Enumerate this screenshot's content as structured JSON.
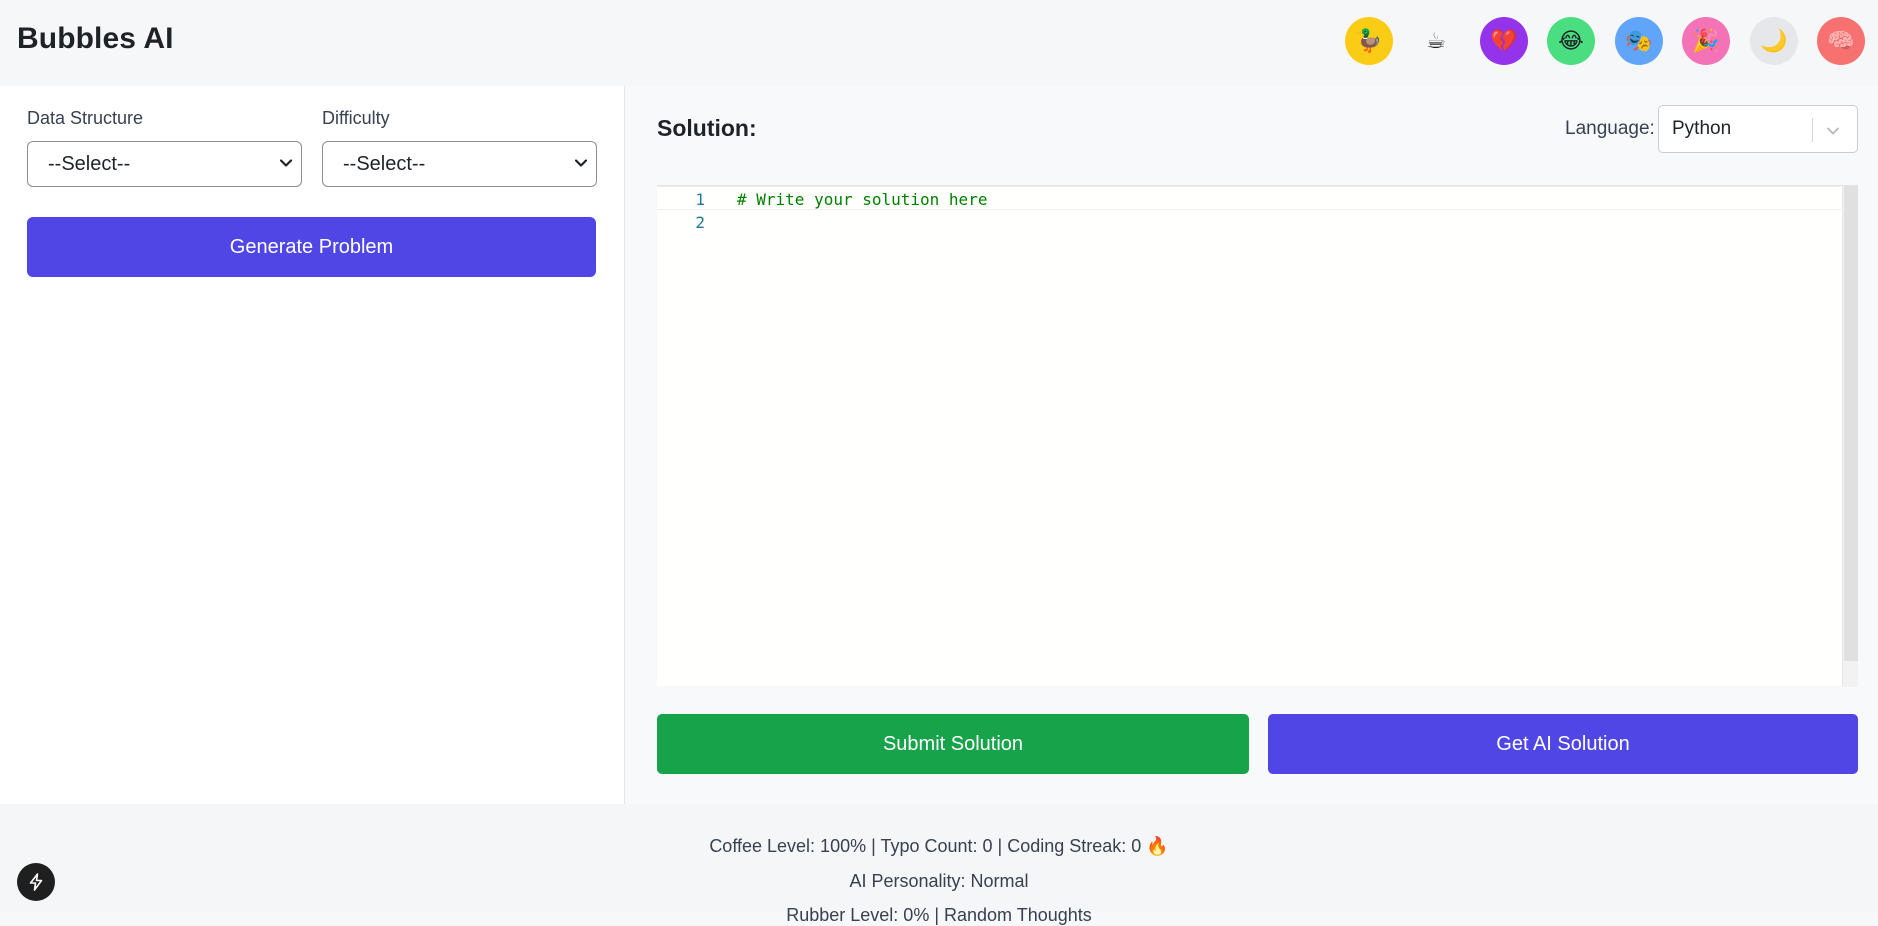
{
  "header": {
    "title": "Bubbles AI",
    "icons": [
      {
        "name": "duck-icon",
        "glyph": "🦆",
        "bg": "#facc15"
      },
      {
        "name": "coffee-icon",
        "glyph": "☕",
        "bg": "#f6f7f9"
      },
      {
        "name": "heart-icon",
        "glyph": "💔",
        "bg": "#9333ea"
      },
      {
        "name": "laugh-icon",
        "glyph": "😂",
        "bg": "#4ade80"
      },
      {
        "name": "theater-icon",
        "glyph": "🎭",
        "bg": "#60a5fa"
      },
      {
        "name": "party-icon",
        "glyph": "🎉",
        "bg": "#f472b6"
      },
      {
        "name": "moon-icon",
        "glyph": "🌙",
        "bg": "#e5e7eb"
      },
      {
        "name": "brain-icon",
        "glyph": "🧠",
        "bg": "#f87171"
      }
    ]
  },
  "left": {
    "data_structure_label": "Data Structure",
    "data_structure_value": "--Select--",
    "difficulty_label": "Difficulty",
    "difficulty_value": "--Select--",
    "generate_label": "Generate Problem"
  },
  "right": {
    "solution_title": "Solution:",
    "language_label": "Language:",
    "language_value": "Python",
    "editor_lines": [
      {
        "num": "1",
        "code": "# Write your solution here"
      },
      {
        "num": "2",
        "code": ""
      }
    ],
    "submit_label": "Submit Solution",
    "ai_label": "Get AI Solution"
  },
  "footer": {
    "status_line_1": "Coffee Level: 100% | Typo Count: 0 | Coding Streak: 0 🔥",
    "status_line_2": "AI Personality: Normal",
    "status_line_3": "Rubber Level: 0% | Random Thoughts"
  },
  "colors": {
    "primary": "#4f46e5",
    "success": "#16a34a"
  }
}
